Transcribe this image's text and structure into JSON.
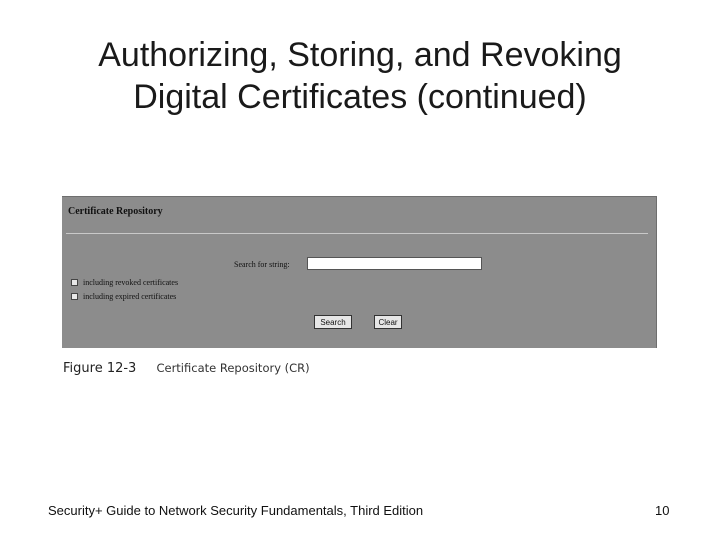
{
  "slide": {
    "title_line1": "Authorizing, Storing, and Revoking",
    "title_line2": "Digital Certificates (continued)"
  },
  "repository": {
    "header": "Certificate Repository",
    "search_label": "Search for string:",
    "search_value": "",
    "checkboxes": [
      {
        "label": "including revoked certificates",
        "checked": false
      },
      {
        "label": "including expired certificates",
        "checked": false
      }
    ],
    "search_button": "Search",
    "clear_button": "Clear"
  },
  "figure": {
    "number": "Figure 12-3",
    "caption": "Certificate Repository (CR)"
  },
  "footer": {
    "book": "Security+ Guide to Network Security Fundamentals, Third Edition",
    "page": "10"
  },
  "colors": {
    "panel_background": "#8c8c8c",
    "divider": "#c9c9c9"
  }
}
